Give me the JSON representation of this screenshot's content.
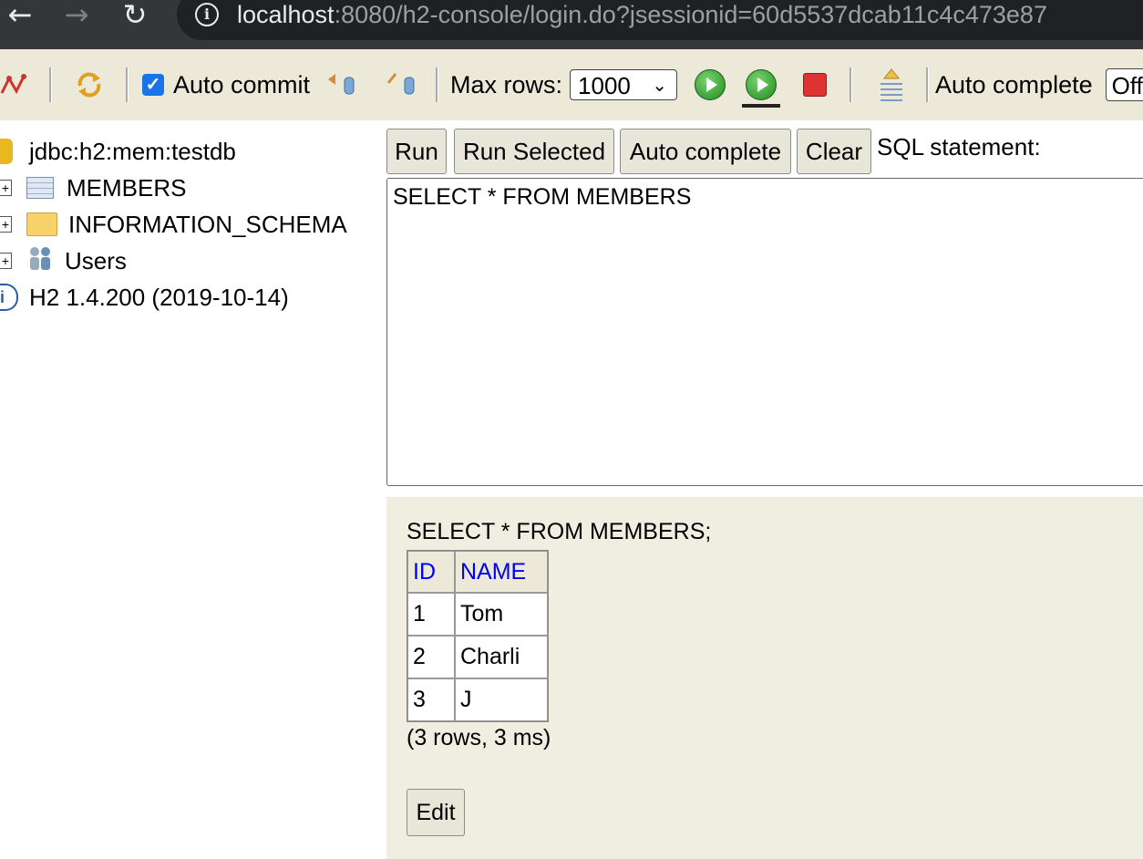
{
  "browser": {
    "back_icon": "arrow-left",
    "forward_icon": "arrow-right",
    "reload_icon": "reload",
    "url_host": "localhost",
    "url_rest": ":8080/h2-console/login.do?jsessionid=60d5537dcab11c4c473e87"
  },
  "toolbar": {
    "autocommit_label": "Auto commit",
    "autocommit_checked": true,
    "maxrows_label": "Max rows:",
    "maxrows_value": "1000",
    "autocomplete_label": "Auto complete",
    "autocomplete_value": "Off"
  },
  "tree": {
    "connection": "jdbc:h2:mem:testdb",
    "items": [
      {
        "label": "MEMBERS",
        "icon": "table-icon"
      },
      {
        "label": "INFORMATION_SCHEMA",
        "icon": "folder-icon"
      },
      {
        "label": "Users",
        "icon": "users-icon"
      }
    ],
    "version": "H2 1.4.200 (2019-10-14)"
  },
  "query": {
    "run_label": "Run",
    "run_selected_label": "Run Selected",
    "auto_complete_label": "Auto complete",
    "clear_label": "Clear",
    "sql_label": "SQL statement:",
    "sql_text": "SELECT * FROM MEMBERS"
  },
  "results": {
    "sql": "SELECT * FROM MEMBERS;",
    "columns": [
      "ID",
      "NAME"
    ],
    "rows": [
      [
        "1",
        "Tom"
      ],
      [
        "2",
        "Charli"
      ],
      [
        "3",
        "J"
      ]
    ],
    "stats": "(3 rows, 3 ms)",
    "edit_label": "Edit"
  },
  "colors": {
    "toolbar_bg": "#ece9d8",
    "results_bg": "#f0eee1",
    "header_link": "#0000ee",
    "browser_bg": "#35363a"
  }
}
